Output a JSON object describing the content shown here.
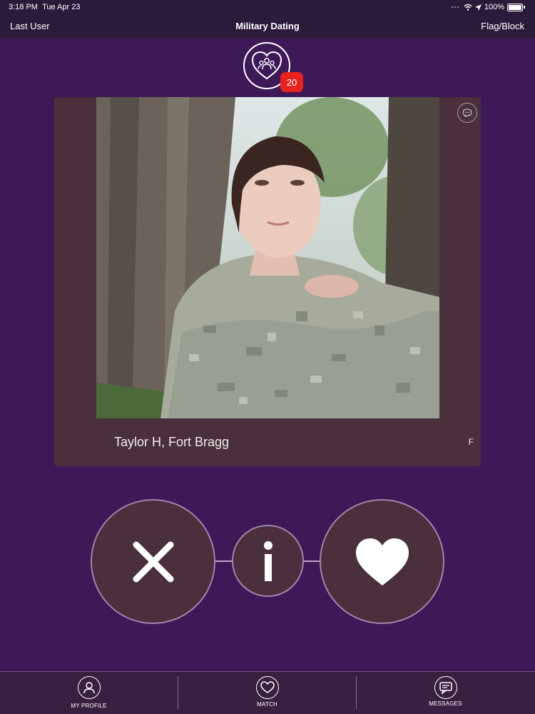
{
  "status_bar": {
    "time": "3:18 PM",
    "date": "Tue Apr 23",
    "battery": "100%"
  },
  "nav": {
    "left": "Last User",
    "title": "Military Dating",
    "right": "Flag/Block"
  },
  "badge": {
    "count": "20"
  },
  "profile": {
    "name": "Taylor H, Fort Bragg",
    "gender": "F"
  },
  "actions": {
    "reject_icon": "close-icon",
    "info_icon": "info-icon",
    "like_icon": "heart-icon"
  },
  "tabs": [
    {
      "label": "MY PROFILE",
      "icon": "person-icon"
    },
    {
      "label": "MATCH",
      "icon": "heart-icon"
    },
    {
      "label": "MESSAGES",
      "icon": "message-icon"
    }
  ],
  "colors": {
    "background": "#3d1957",
    "card": "#4a2f3d",
    "badge": "#e8231e",
    "bars": "#2b1a3a"
  }
}
